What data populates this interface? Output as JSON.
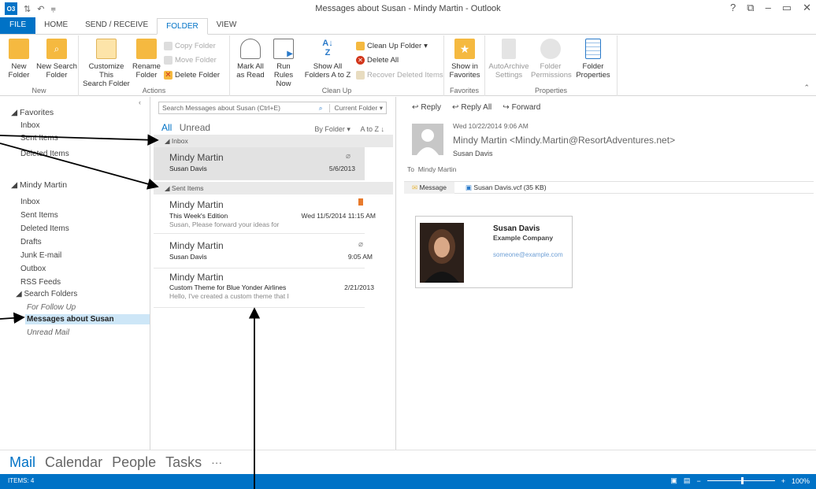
{
  "window": {
    "title": "Messages about Susan - Mindy Martin - Outlook",
    "app_icon": "O3",
    "controls": [
      "?",
      "⧉",
      "–",
      "▭",
      "✕"
    ]
  },
  "tabs": [
    "FILE",
    "HOME",
    "SEND / RECEIVE",
    "FOLDER",
    "VIEW"
  ],
  "ribbon": {
    "new_group": {
      "label": "New",
      "new_folder": "New\nFolder",
      "new_search_folder": "New Search\nFolder"
    },
    "actions_group": {
      "label": "Actions",
      "customize": "Customize This\nSearch Folder",
      "rename": "Rename\nFolder",
      "copy_folder": "Copy Folder",
      "move_folder": "Move Folder",
      "delete_folder": "Delete Folder"
    },
    "cleanup_group": {
      "label": "Clean Up",
      "mark_all_read": "Mark All\nas Read",
      "run_rules": "Run Rules\nNow",
      "show_all": "Show All\nFolders A to Z",
      "clean_up_folder": "Clean Up Folder",
      "delete_all": "Delete All",
      "recover": "Recover Deleted Items"
    },
    "favorites_group": {
      "label": "Favorites",
      "show_in_favorites": "Show in\nFavorites"
    },
    "properties_group": {
      "label": "Properties",
      "autoarchive": "AutoArchive\nSettings",
      "folder_permissions": "Folder\nPermissions",
      "folder_properties": "Folder\nProperties"
    }
  },
  "nav": {
    "favorites_header": "Favorites",
    "favorites": [
      "Inbox",
      "Sent Items",
      "Deleted Items"
    ],
    "account_header": "Mindy Martin",
    "folders": [
      "Inbox",
      "Sent Items",
      "Deleted Items",
      "Drafts",
      "Junk E-mail",
      "Outbox",
      "RSS Feeds"
    ],
    "search_folders_header": "Search Folders",
    "search_folders": [
      "For Follow Up",
      "Messages about Susan",
      "Unread Mail"
    ]
  },
  "message_list": {
    "search_placeholder": "Search Messages about Susan (Ctrl+E)",
    "search_scope": "Current Folder",
    "filter_all": "All",
    "filter_unread": "Unread",
    "arrange_by": "By Folder",
    "sort_order": "A to Z",
    "groups": [
      {
        "name": "Inbox",
        "messages": [
          {
            "sender": "Mindy Martin",
            "subject": "Susan Davis",
            "preview": "",
            "date": "5/6/2013"
          }
        ]
      },
      {
        "name": "Sent Items",
        "messages": [
          {
            "sender": "Mindy Martin",
            "subject": "This Week's Edition",
            "preview": "Susan,  Please forward your ideas for",
            "date": "Wed 11/5/2014 11:15 AM"
          },
          {
            "sender": "Mindy Martin",
            "subject": "Susan Davis",
            "preview": "",
            "date": "9:05 AM"
          },
          {
            "sender": "Mindy Martin",
            "subject": "Custom Theme for Blue Yonder Airlines",
            "preview": "Hello,  I've created a custom theme that I",
            "date": "2/21/2013"
          }
        ]
      }
    ]
  },
  "reading": {
    "reply": "Reply",
    "reply_all": "Reply All",
    "forward": "Forward",
    "date": "Wed 10/22/2014 9:06 AM",
    "from": "Mindy Martin <Mindy.Martin@ResortAdventures.net>",
    "subject": "Susan Davis",
    "to_label": "To",
    "to": "Mindy Martin",
    "message_tab": "Message",
    "attachment": "Susan Davis.vcf (35 KB)",
    "card": {
      "name": "Susan Davis",
      "company": "Example Company",
      "email": "someone@example.com"
    }
  },
  "bottom_nav": [
    "Mail",
    "Calendar",
    "People",
    "Tasks",
    "···"
  ],
  "status": {
    "items": "ITEMS: 4",
    "zoom": "100%"
  }
}
